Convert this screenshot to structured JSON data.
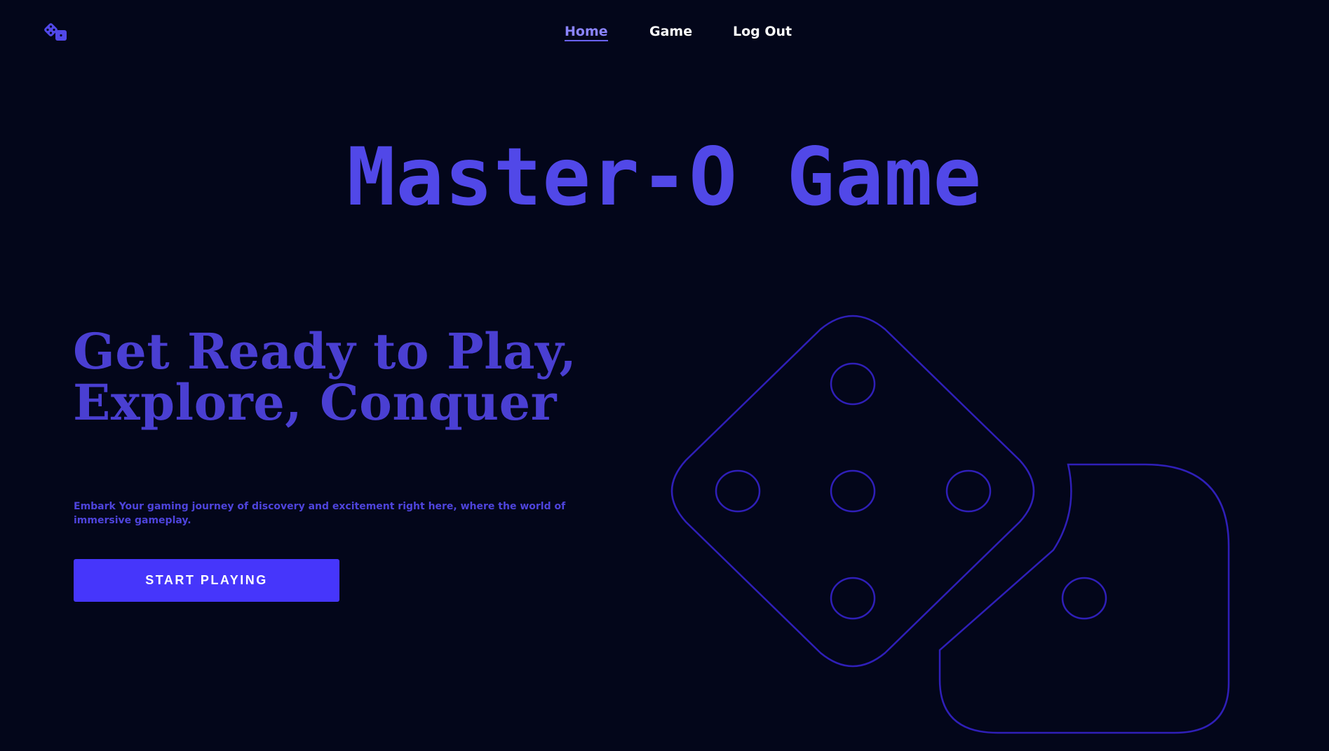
{
  "header": {
    "logo_icon": "dice-icon",
    "nav": {
      "home": "Home",
      "game": "Game",
      "logout": "Log Out"
    }
  },
  "main": {
    "title": "Master-O Game",
    "hero": {
      "heading": "Get Ready to Play, Explore, Conquer",
      "text": "Embark Your gaming journey of discovery and excitement right here, where the world of immersive gameplay.",
      "cta_label": "START PLAYING"
    },
    "illustration_icon": "dice-illustration"
  },
  "colors": {
    "background": "#03061a",
    "accent": "#5148e8",
    "button": "#4636fb",
    "dice_outline": "#2f1fb8"
  }
}
